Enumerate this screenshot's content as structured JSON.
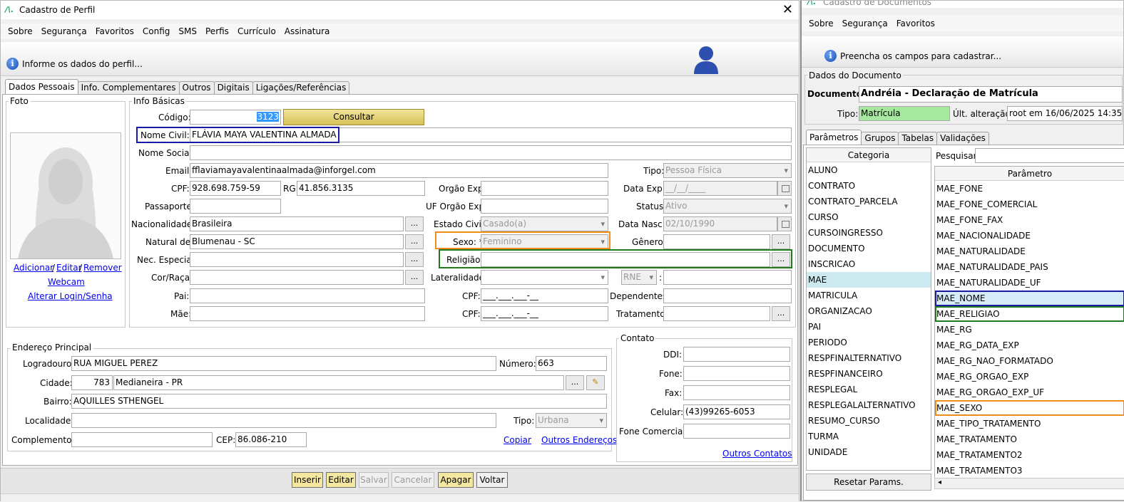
{
  "left": {
    "title": "Cadastro de Perfil",
    "menu": [
      "Sobre",
      "Segurança",
      "Favoritos",
      "Config",
      "SMS",
      "Perfis",
      "Currículo",
      "Assinatura"
    ],
    "info": "Informe os dados do perfil...",
    "tabs": [
      "Dados Pessoais",
      "Info. Complementares",
      "Outros",
      "Digitais",
      "Ligações/Referências"
    ],
    "foto": {
      "group": "Foto",
      "add": "Adicionar",
      "sep1": "/",
      "edit": "Editar",
      "sep2": "/",
      "remove": "Remover",
      "webcam": "Webcam",
      "login": "Alterar Login/Senha"
    },
    "info_basicas": {
      "group": "Info Básicas",
      "codigo_label": "Código:",
      "codigo": "3123",
      "consultar": "Consultar",
      "nome_civil_label": "Nome Civil:*",
      "nome_civil": "FLÁVIA MAYA VALENTINA ALMADA",
      "nome_social_label": "Nome Social:",
      "nome_social": "",
      "email_label": "Email:",
      "email": "fflaviamayavalentinaalmada@inforgel.com",
      "tipo_label": "Tipo:",
      "tipo": "Pessoa Física",
      "cpf_label": "CPF:",
      "cpf": "928.698.759-59",
      "rg_label": "RG:",
      "rg": "41.856.3135",
      "orgao_exp_label": "Orgão Exp:",
      "orgao_exp": "",
      "data_exp_label": "Data Exp.:",
      "data_exp": "__/__/____",
      "passaporte_label": "Passaporte:",
      "passaporte": "",
      "uf_orgao_label": "UF Orgão Exp:",
      "uf_orgao": "",
      "status_label": "Status:",
      "status": "Ativo",
      "nacionalidade_label": "Nacionalidade:",
      "nacionalidade": "Brasileira",
      "estado_civil_label": "Estado Civil:",
      "estado_civil": "Casado(a)",
      "data_nasc_label": "Data Nasc.:",
      "data_nasc": "02/10/1990",
      "natural_label": "Natural de:",
      "natural": "Blumenau - SC",
      "sexo_label": "Sexo: *",
      "sexo": "Feminino",
      "genero_label": "Gênero:",
      "genero": "",
      "nec_label": "Nec. Especial:",
      "nec": "",
      "religiao_label": "Religião:",
      "religiao": "",
      "cor_label": "Cor/Raça:",
      "cor": "",
      "lateralidade_label": "Lateralidade:",
      "lateralidade": "",
      "rne": "RNE",
      "rne_sep": ":",
      "pai_label": "Pai:",
      "pai": "",
      "pai_cpf_label": "CPF:",
      "pai_cpf": "___.___.___-__",
      "dependentes_label": "Dependentes:",
      "dependentes": "",
      "mae_label": "Mãe:",
      "mae": "",
      "mae_cpf_label": "CPF:",
      "mae_cpf": "___.___.___-__",
      "tratamento_label": "Tratamento:",
      "tratamento": "",
      "dots": "..."
    },
    "endereco": {
      "group": "Endereço Principal",
      "logradouro_label": "Logradouro:",
      "logradouro": "RUA MIGUEL PEREZ",
      "numero_label": "Número:",
      "numero": "663",
      "cidade_label": "Cidade:",
      "cidade_cod": "783",
      "cidade": "Medianeira - PR",
      "bairro_label": "Bairro:",
      "bairro": "AQUILLES STHENGEL",
      "localidade_label": "Localidade:",
      "localidade": "",
      "tipo_label": "Tipo:",
      "tipo": "Urbana",
      "complemento_label": "Complemento:",
      "complemento": "",
      "cep_label": "CEP:",
      "cep": "86.086-210",
      "copiar": "Copiar",
      "outros": "Outros Endereços"
    },
    "contato": {
      "group": "Contato",
      "ddi_label": "DDI:",
      "ddi": "",
      "fone_label": "Fone:",
      "fone": "",
      "fax_label": "Fax:",
      "fax": "",
      "celular_label": "Celular:",
      "celular": "(43)99265-6053",
      "fone_com_label": "Fone Comercial:",
      "fone_com": "",
      "outros": "Outros Contatos"
    },
    "buttons": {
      "inserir": "Inserir",
      "editar": "Editar",
      "salvar": "Salvar",
      "cancelar": "Cancelar",
      "apagar": "Apagar",
      "voltar": "Voltar"
    }
  },
  "right": {
    "title": "Cadastro de Documentos",
    "menu": [
      "Sobre",
      "Segurança",
      "Favoritos"
    ],
    "info": "Preencha os campos para cadastrar...",
    "group": "Dados do Documento",
    "documento_label": "Documento:",
    "documento": "Andréia - Declaração de Matrícula",
    "tipo_label": "Tipo:",
    "tipo": "Matrícula",
    "ult_label": "Últ. alteração:",
    "ult": "root em 16/06/2025 14:35",
    "tabs": [
      "Parâmetros",
      "Grupos",
      "Tabelas",
      "Validações"
    ],
    "categoria_header": "Categoria",
    "categorias": [
      "ALUNO",
      "CONTRATO",
      "CONTRATO_PARCELA",
      "CURSO",
      "CURSOINGRESSO",
      "DOCUMENTO",
      "INSCRICAO",
      "MAE",
      "MATRICULA",
      "ORGANIZACAO",
      "PAI",
      "PERIODO",
      "RESPFINALTERNATIVO",
      "RESPFINANCEIRO",
      "RESPLEGAL",
      "RESPLEGALALTERNATIVO",
      "RESUMO_CURSO",
      "TURMA",
      "UNIDADE"
    ],
    "selected_categoria": "MAE",
    "pesquisar_label": "Pesquisar:",
    "pesquisar": "",
    "parametro_header": "Parâmetro",
    "parametros": [
      "MAE_FONE",
      "MAE_FONE_COMERCIAL",
      "MAE_FONE_FAX",
      "MAE_NACIONALIDADE",
      "MAE_NATURALIDADE",
      "MAE_NATURALIDADE_PAIS",
      "MAE_NATURALIDADE_UF",
      "MAE_NOME",
      "MAE_RELIGIAO",
      "MAE_RG",
      "MAE_RG_DATA_EXP",
      "MAE_RG_NAO_FORMATADO",
      "MAE_RG_ORGAO_EXP",
      "MAE_RG_ORGAO_EXP_UF",
      "MAE_SEXO",
      "MAE_TIPO_TRATAMENTO",
      "MAE_TRATAMENTO",
      "MAE_TRATAMENTO2",
      "MAE_TRATAMENTO3"
    ],
    "reset": "Resetar Params."
  },
  "colors": {
    "highlight_blue": "#1a1aa6",
    "highlight_green": "#1e7b1e",
    "highlight_orange": "#f08c1a",
    "tipo_green": "#a6e8a0",
    "selected_row": "#cdeaf0",
    "button_yellow": "#f4e7a0"
  }
}
